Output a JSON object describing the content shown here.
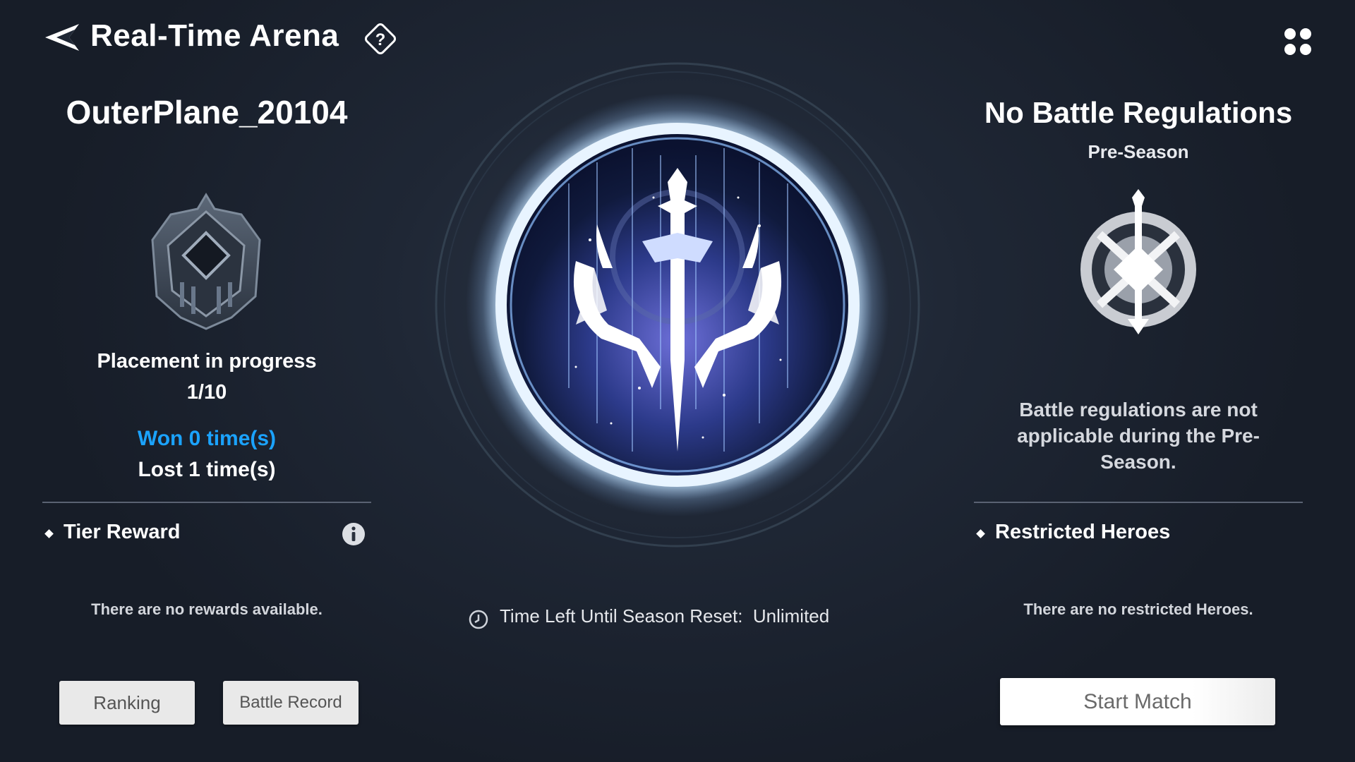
{
  "header": {
    "title": "Real-Time Arena",
    "back_icon": "back-arrow-icon",
    "help_icon": "question-circle-icon",
    "menu_icon": "four-dots-menu-icon"
  },
  "player": {
    "name": "OuterPlane_20104",
    "placement_label": "Placement in progress",
    "placement_count": "1/10",
    "won": "Won 0 time(s)",
    "lost": "Lost 1 time(s)"
  },
  "tier_reward": {
    "title": "Tier Reward",
    "empty_text": "There are no rewards available."
  },
  "buttons": {
    "ranking": "Ranking",
    "battle_record": "Battle Record",
    "start_match": "Start Match"
  },
  "season": {
    "timer_label": "Time Left Until Season Reset:  Unlimited"
  },
  "regulations": {
    "title": "No Battle Regulations",
    "subtitle": "Pre-Season",
    "description": "Battle regulations are not applicable during the Pre-Season.",
    "restricted_title": "Restricted Heroes",
    "restricted_empty": "There are no restricted Heroes."
  },
  "colors": {
    "won_blue": "#1ba3ff",
    "emblem_glow": "#cfe6ff",
    "background": "#1f2735"
  }
}
